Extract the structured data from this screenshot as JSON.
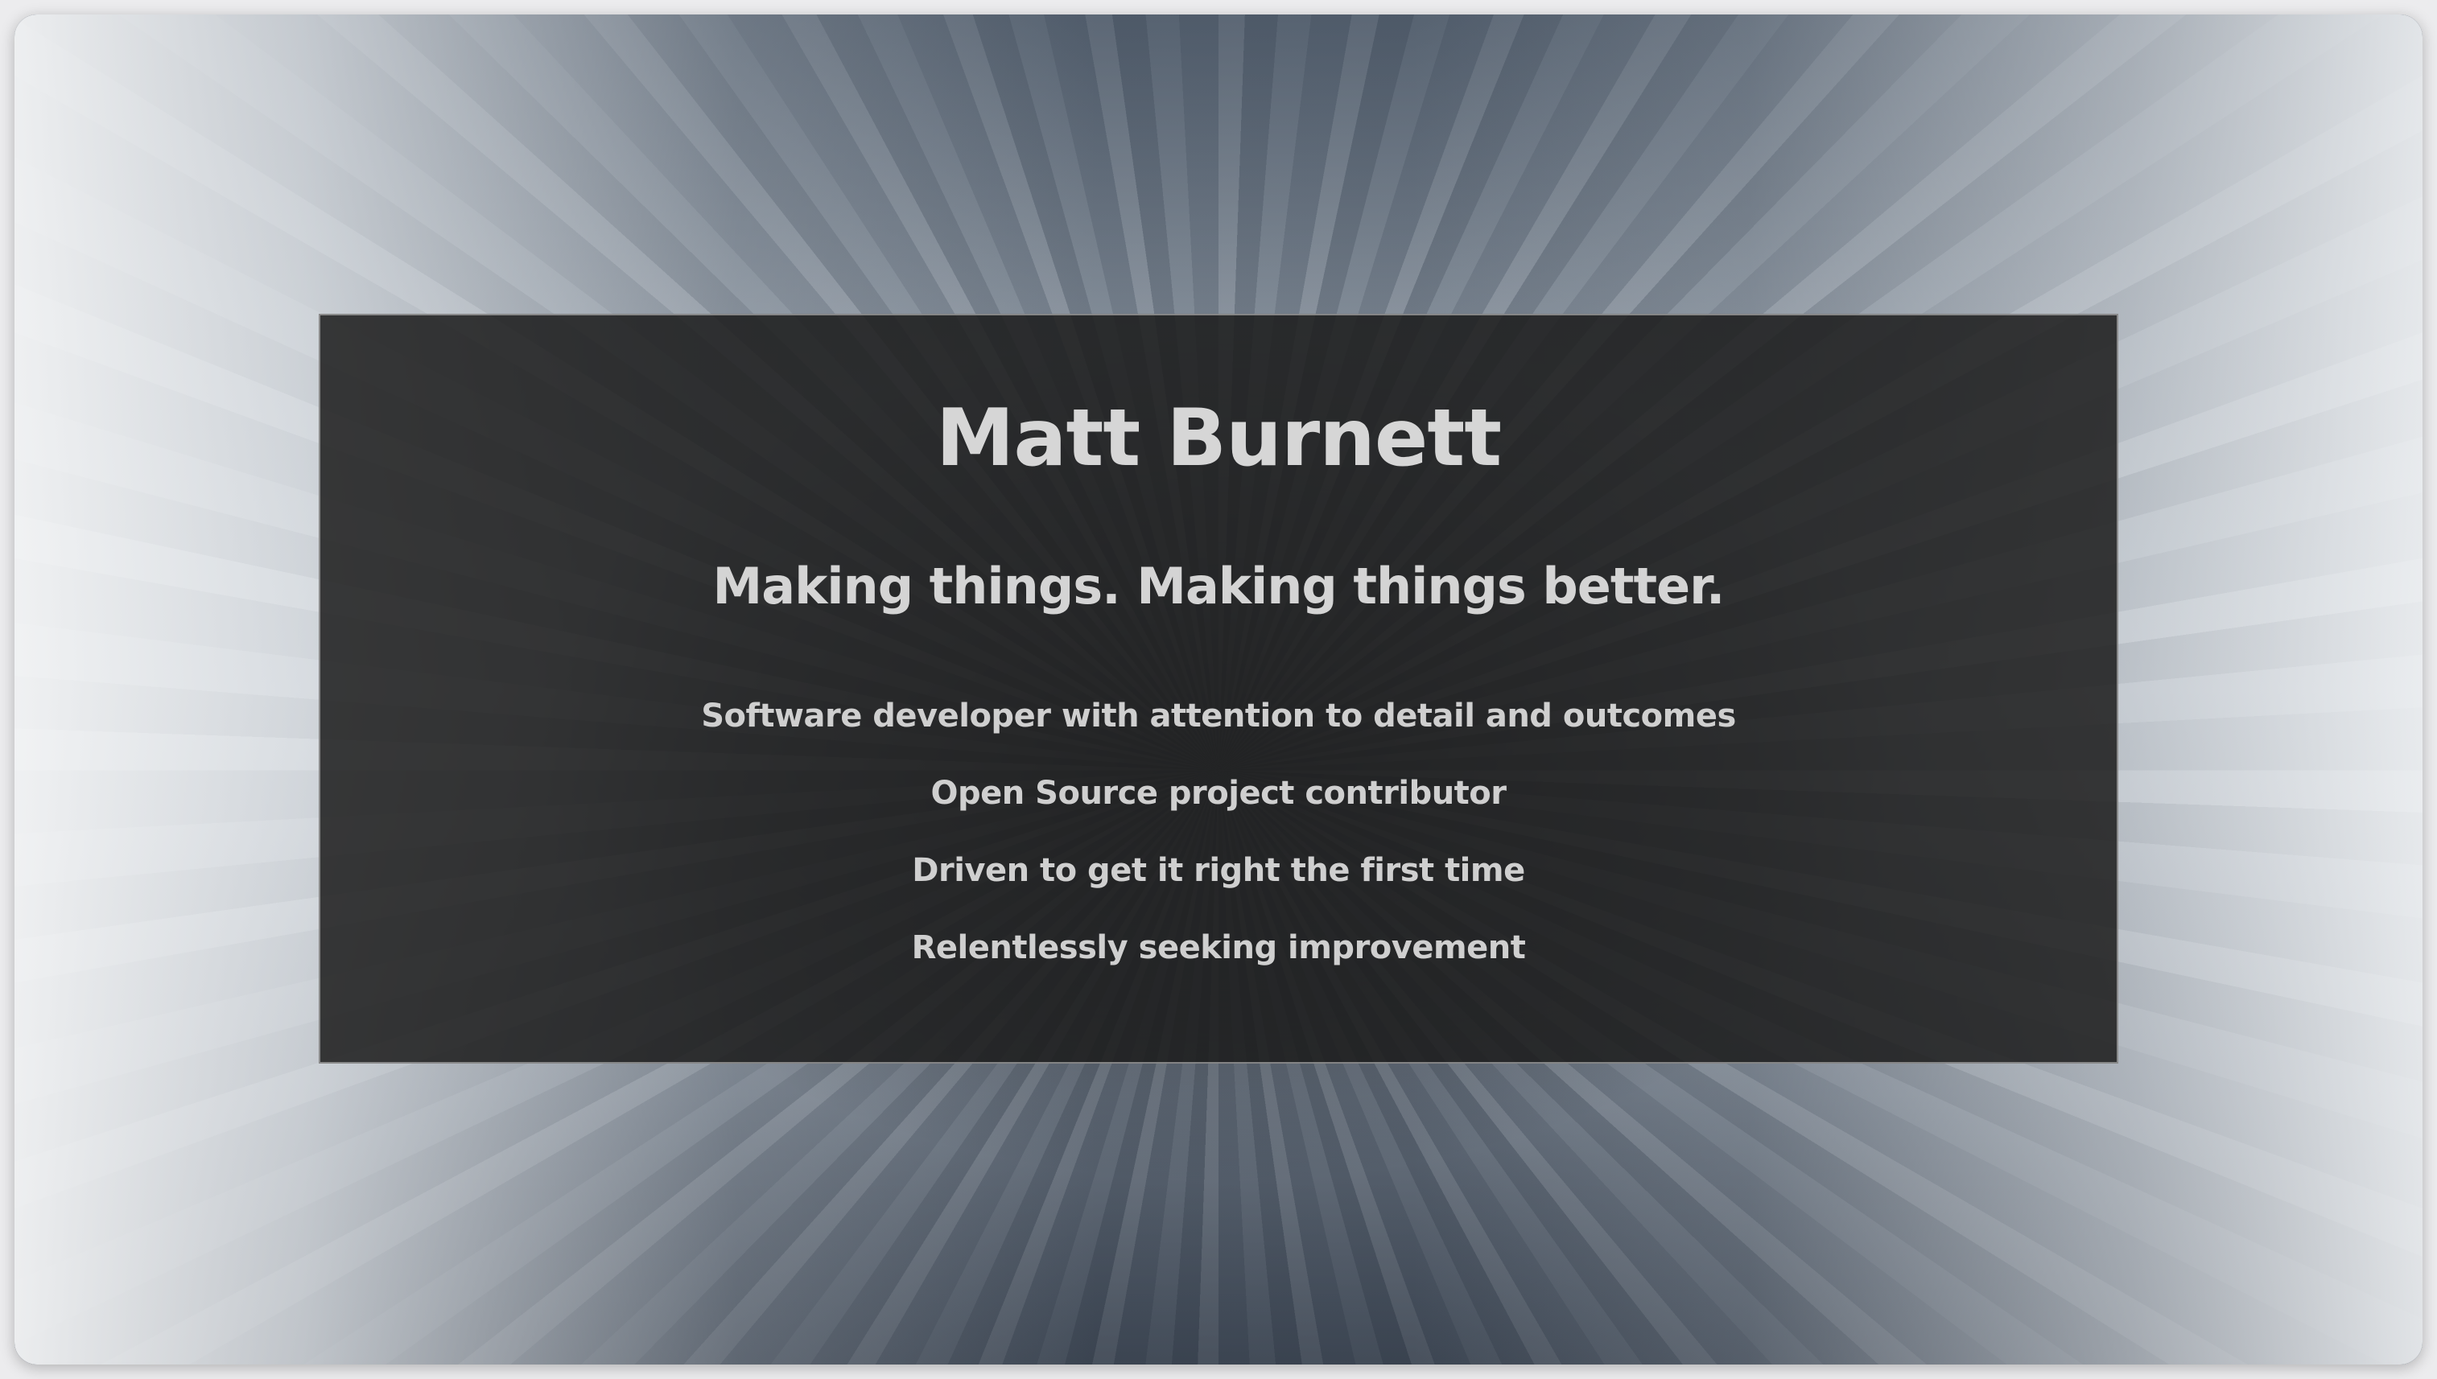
{
  "profile": {
    "name": "Matt Burnett",
    "tagline": "Making things. Making things better.",
    "highlights": [
      "Software developer with attention to detail and outcomes",
      "Open Source project contributor",
      "Driven to get it right the first time",
      "Relentlessly seeking improvement"
    ]
  },
  "background": {
    "image": "motion-blur-tunnel-background",
    "panel_color": "#1c1c1c",
    "text_color": "#d2d2d2"
  }
}
